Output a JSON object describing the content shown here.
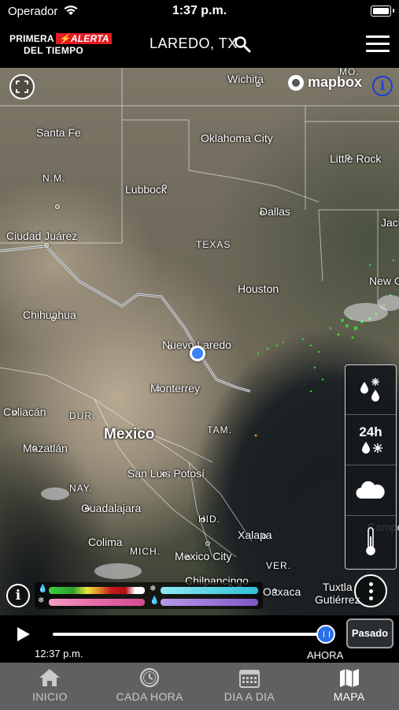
{
  "status_bar": {
    "carrier": "Operador",
    "time": "1:37 p.m."
  },
  "header": {
    "logo_line1_a": "PRIMERA",
    "logo_line1_b": "ALERTA",
    "logo_line2": "DEL TIEMPO",
    "location": "LAREDO, TX"
  },
  "map": {
    "attribution": "mapbox",
    "info_glyph": "i",
    "labels": [
      {
        "text": "Wichita",
        "cls": "city"
      },
      {
        "text": "MO.",
        "cls": "city small"
      },
      {
        "text": "Santa Fe",
        "cls": "city"
      },
      {
        "text": "Oklahoma City",
        "cls": "city"
      },
      {
        "text": "Little Rock",
        "cls": "city"
      },
      {
        "text": "N.M.",
        "cls": "city small"
      },
      {
        "text": "Lubbock",
        "cls": "city"
      },
      {
        "text": "Dallas",
        "cls": "city"
      },
      {
        "text": "Jack",
        "cls": "city"
      },
      {
        "text": "Ciudad Juárez",
        "cls": "city"
      },
      {
        "text": "TEXAS",
        "cls": "city small"
      },
      {
        "text": "Houston",
        "cls": "city"
      },
      {
        "text": "New O",
        "cls": "city"
      },
      {
        "text": "Chihuahua",
        "cls": "city"
      },
      {
        "text": "Nuevo Laredo",
        "cls": "city"
      },
      {
        "text": "Monterrey",
        "cls": "city"
      },
      {
        "text": "Culiacán",
        "cls": "city"
      },
      {
        "text": "DUR.",
        "cls": "city small"
      },
      {
        "text": "Mexico",
        "cls": "city big"
      },
      {
        "text": "TAM.",
        "cls": "city small"
      },
      {
        "text": "Mazatlán",
        "cls": "city"
      },
      {
        "text": "San Luis Potosí",
        "cls": "city"
      },
      {
        "text": "NAY.",
        "cls": "city small"
      },
      {
        "text": "Guadalajara",
        "cls": "city"
      },
      {
        "text": "HID.",
        "cls": "city small"
      },
      {
        "text": "Campe",
        "cls": "city"
      },
      {
        "text": "Colima",
        "cls": "city"
      },
      {
        "text": "Xalapa",
        "cls": "city"
      },
      {
        "text": "MICH.",
        "cls": "city small"
      },
      {
        "text": "Mexico City",
        "cls": "city"
      },
      {
        "text": "VER.",
        "cls": "city small"
      },
      {
        "text": "Chilpancingo",
        "cls": "city"
      },
      {
        "text": "Oaxaca",
        "cls": "city"
      },
      {
        "text": "Tuxtla",
        "cls": "city"
      },
      {
        "text": "Gutiérrez",
        "cls": "city"
      }
    ],
    "layers": {
      "h24_label": "24h"
    },
    "legend_info_glyph": "i",
    "colors": {
      "location_pin": "#3b82f6",
      "info_blue": "#1a3fd6",
      "radar_green": "#3cd13c"
    }
  },
  "timeline": {
    "start_time": "12:37 p.m.",
    "now_label": "AHORA",
    "past_button": "Pasado",
    "progress": 1.0
  },
  "tabs": [
    {
      "label": "INICIO",
      "icon": "home-icon",
      "active": false
    },
    {
      "label": "CADA HORA",
      "icon": "clock-icon",
      "active": false
    },
    {
      "label": "DIA A DIA",
      "icon": "calendar-icon",
      "active": false
    },
    {
      "label": "MAPA",
      "icon": "map-icon",
      "active": true
    }
  ]
}
